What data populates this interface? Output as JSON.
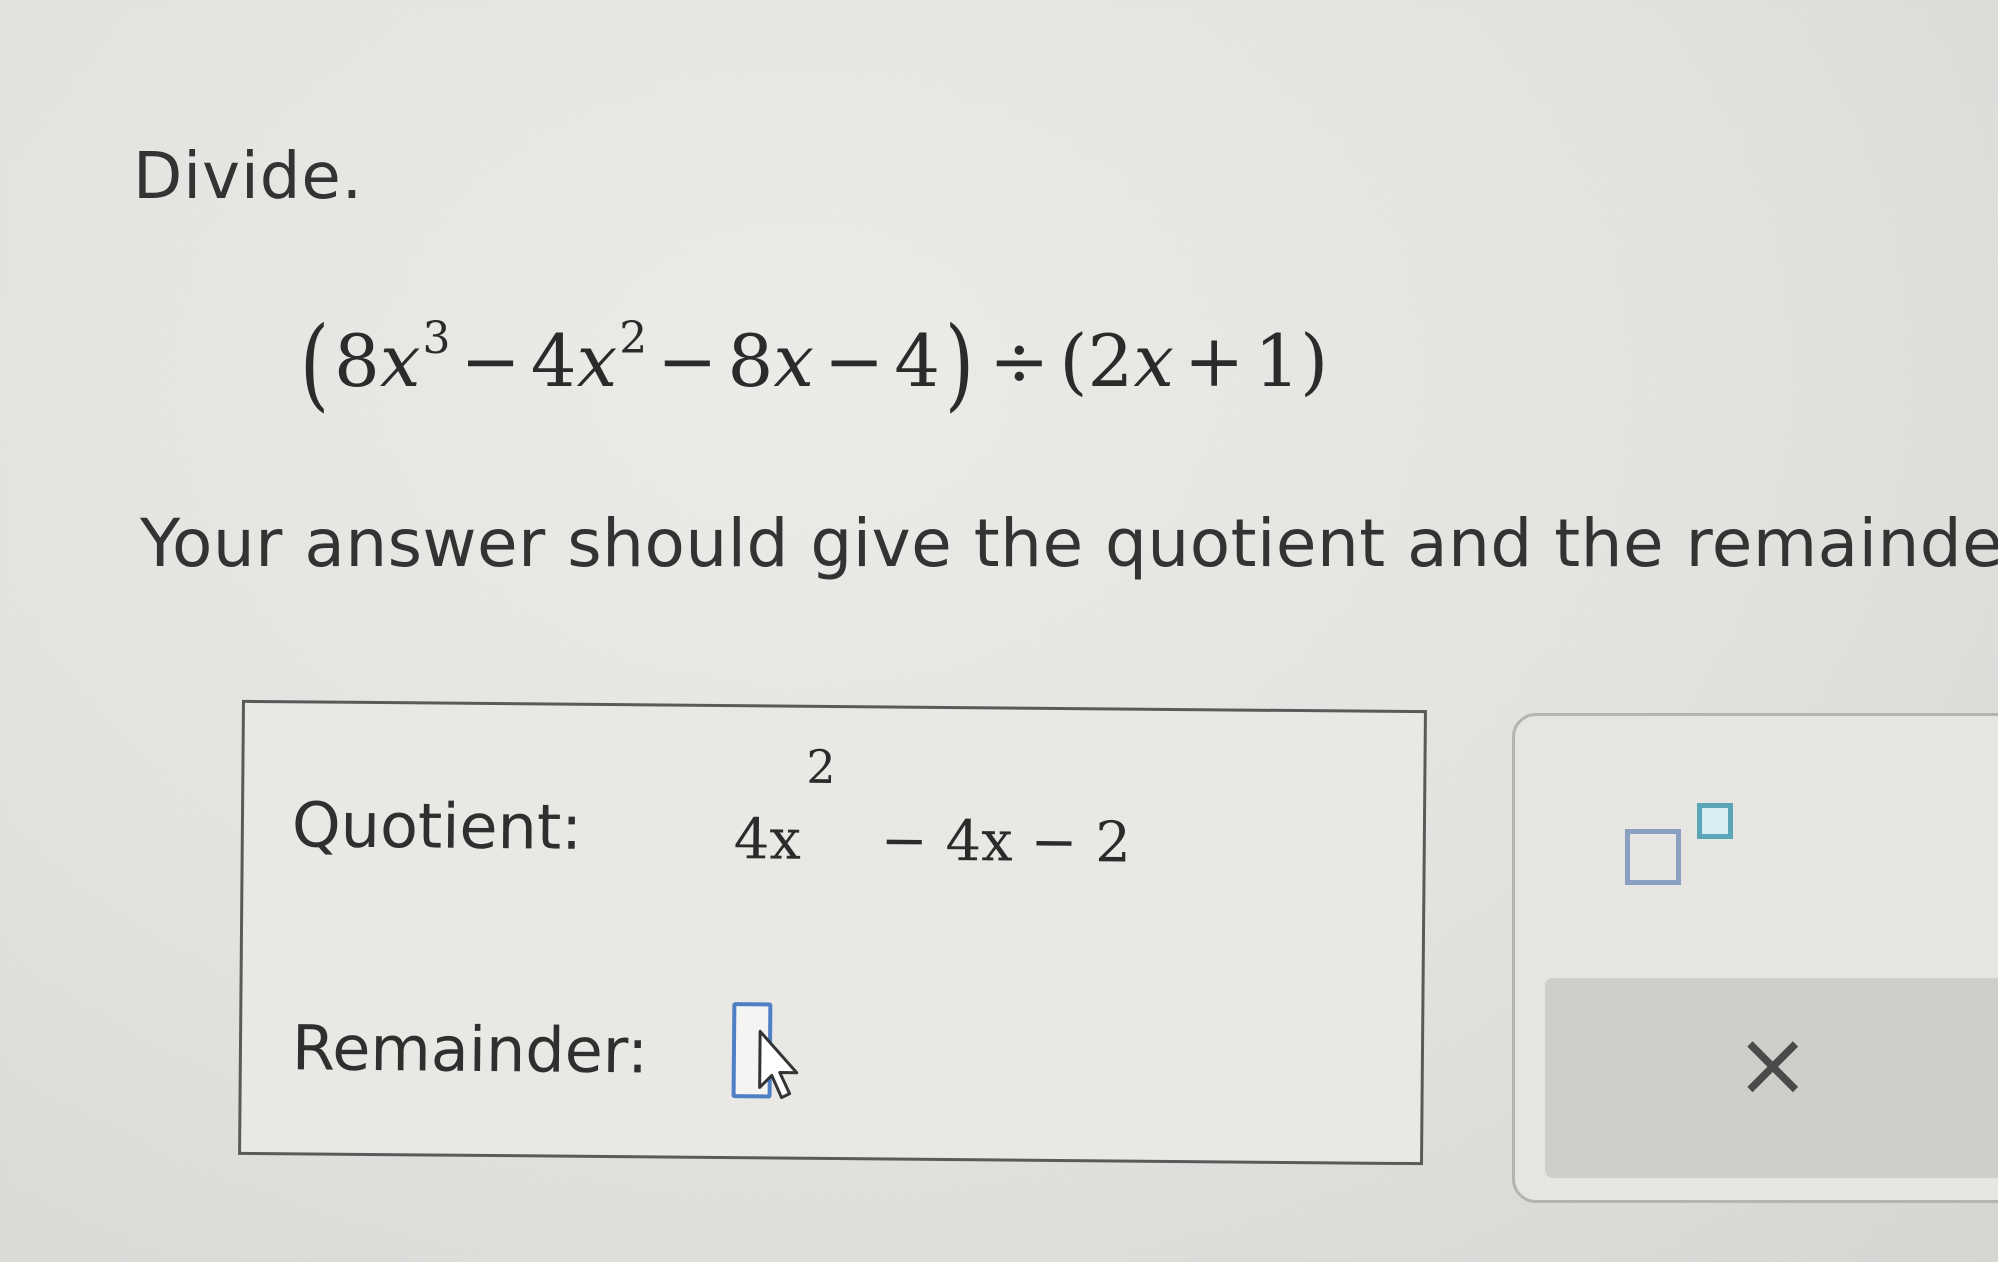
{
  "instruction": "Divide.",
  "problem": {
    "open_paren": "(",
    "t1_coef": "8",
    "t1_var": "x",
    "t1_exp": "3",
    "op1": "−",
    "t2_coef": "4",
    "t2_var": "x",
    "t2_exp": "2",
    "op2": "−",
    "t3": "8",
    "t3_var": "x",
    "op3": "−",
    "t4": "4",
    "close_paren": ")",
    "divide": "÷",
    "d_open": "(",
    "d1": "2",
    "d1_var": "x",
    "d_op": "+",
    "d2": "1",
    "d_close": ")"
  },
  "note": "Your answer should give the quotient and the remainde",
  "answer": {
    "quotient_label": "Quotient:",
    "quotient_base": "4x",
    "quotient_exp": "2",
    "quotient_rest": "− 4x − 2",
    "remainder_label": "Remainder:",
    "remainder_value": ""
  },
  "tools": {
    "exponent_icon": "exponent-template-icon",
    "clear_symbol": "×"
  },
  "colors": {
    "input_border": "#4f7fc4",
    "exponent_accent": "#5aa6b8"
  }
}
